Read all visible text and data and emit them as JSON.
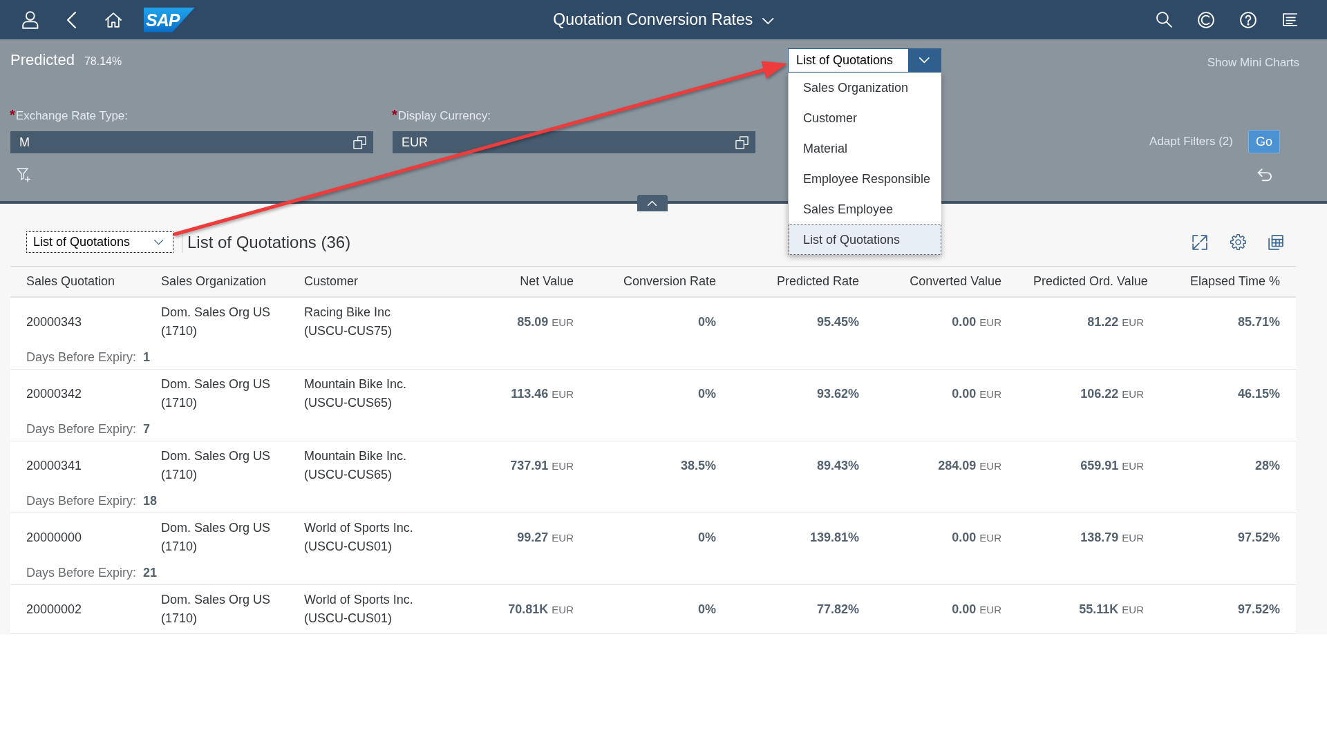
{
  "shell_bar": {
    "logo": "SAP",
    "title": "Quotation Conversion Rates"
  },
  "header": {
    "title": "Predicted",
    "value": "78.14%",
    "link": "Show Mini Charts"
  },
  "view_switch": {
    "value": "List of Quotations",
    "expanded": true,
    "options": [
      {
        "label": "Sales Organization",
        "selected": false
      },
      {
        "label": "Customer",
        "selected": false
      },
      {
        "label": "Material",
        "selected": false
      },
      {
        "label": "Employee Responsible",
        "selected": false
      },
      {
        "label": "Sales Employee",
        "selected": false
      },
      {
        "label": "List of Quotations",
        "selected": true
      }
    ]
  },
  "filters": [
    {
      "label": "Exchange Rate Type:",
      "required_mark": "*",
      "value": "M"
    },
    {
      "label": "Display Currency:",
      "required_mark": "*",
      "value": "EUR"
    }
  ],
  "filter_actions": {
    "adapt_filters": "Adapt Filters (2)",
    "go": "Go"
  },
  "table": {
    "variant_select": {
      "value": "List of Quotations",
      "focused": true
    },
    "title": "List of Quotations (36)",
    "columns": [
      {
        "label": "Sales Quotation",
        "kind": "text"
      },
      {
        "label": "Sales Organization",
        "kind": "text"
      },
      {
        "label": "Customer",
        "kind": "text"
      },
      {
        "label": "Net Value",
        "kind": "amount"
      },
      {
        "label": "Conversion Rate",
        "kind": "percent"
      },
      {
        "label": "Predicted Rate",
        "kind": "percent"
      },
      {
        "label": "Converted Value",
        "kind": "amount"
      },
      {
        "label": "Predicted Ord. Value",
        "kind": "amount"
      },
      {
        "label": "Elapsed Time %",
        "kind": "percent"
      }
    ],
    "rows": [
      {
        "cells": [
          "20000343",
          "Dom. Sales Org US (1710)",
          "Racing Bike Inc (USCU-CUS75)",
          {
            "value": "85.09",
            "unit": "EUR"
          },
          "0%",
          "95.45%",
          {
            "value": "0.00",
            "unit": "EUR"
          },
          {
            "value": "81.22",
            "unit": "EUR"
          },
          "85.71%"
        ],
        "days_before_expiry": {
          "label": "Days Before Expiry:",
          "value": "1"
        }
      },
      {
        "cells": [
          "20000342",
          "Dom. Sales Org US (1710)",
          "Mountain Bike Inc. (USCU-CUS65)",
          {
            "value": "113.46",
            "unit": "EUR"
          },
          "0%",
          "93.62%",
          {
            "value": "0.00",
            "unit": "EUR"
          },
          {
            "value": "106.22",
            "unit": "EUR"
          },
          "46.15%"
        ],
        "days_before_expiry": {
          "label": "Days Before Expiry:",
          "value": "7"
        }
      },
      {
        "cells": [
          "20000341",
          "Dom. Sales Org US (1710)",
          "Mountain Bike Inc. (USCU-CUS65)",
          {
            "value": "737.91",
            "unit": "EUR"
          },
          "38.5%",
          "89.43%",
          {
            "value": "284.09",
            "unit": "EUR"
          },
          {
            "value": "659.91",
            "unit": "EUR"
          },
          "28%"
        ],
        "days_before_expiry": {
          "label": "Days Before Expiry:",
          "value": "18"
        }
      },
      {
        "cells": [
          "20000000",
          "Dom. Sales Org US (1710)",
          "World of Sports Inc. (USCU-CUS01)",
          {
            "value": "99.27",
            "unit": "EUR"
          },
          "0%",
          "139.81%",
          {
            "value": "0.00",
            "unit": "EUR"
          },
          {
            "value": "138.79",
            "unit": "EUR"
          },
          "97.52%"
        ],
        "days_before_expiry": {
          "label": "Days Before Expiry:",
          "value": "21"
        }
      },
      {
        "cells": [
          "20000002",
          "Dom. Sales Org US (1710)",
          "World of Sports Inc. (USCU-CUS01)",
          {
            "value": "70.81K",
            "unit": "EUR"
          },
          "0%",
          "77.82%",
          {
            "value": "0.00",
            "unit": "EUR"
          },
          {
            "value": "55.11K",
            "unit": "EUR"
          },
          "97.52%"
        ]
      }
    ]
  }
}
